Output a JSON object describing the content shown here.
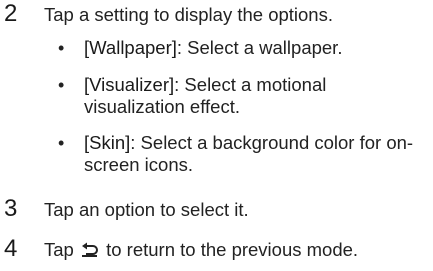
{
  "steps": [
    {
      "number": "2",
      "text": "Tap a setting to display the options.",
      "bullets": [
        {
          "keyword": "[Wallpaper]",
          "text": ": Select a wallpaper."
        },
        {
          "keyword": "[Visualizer]",
          "text": ": Select a motional visualization effect."
        },
        {
          "keyword": "[Skin]",
          "text": ": Select a background color for on-screen icons."
        }
      ]
    },
    {
      "number": "3",
      "text": "Tap an option to select it."
    },
    {
      "number": "4",
      "text_before_icon": "Tap ",
      "icon": "return-icon",
      "text_after_icon": " to return to the previous mode."
    }
  ],
  "bullet_symbol": "•"
}
